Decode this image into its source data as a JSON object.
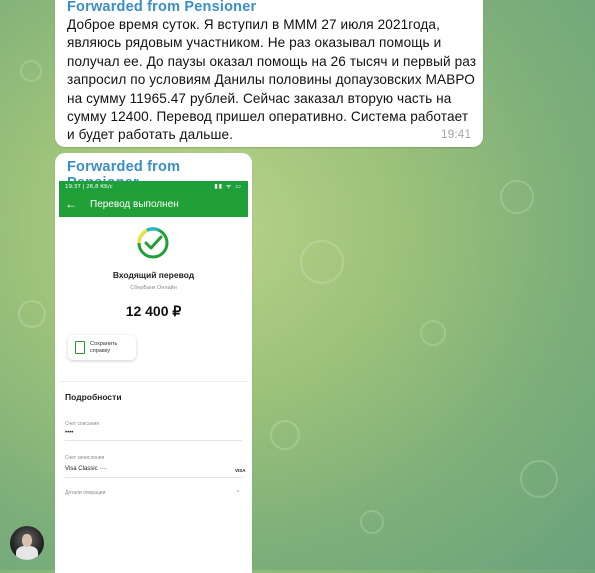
{
  "message1": {
    "forwarded_from": "Forwarded from Pensioner",
    "text": "Доброе время суток. Я вступил в МММ 27 июля 2021года, являюсь рядовым участником. Не раз оказывал помощь и получал ее. До паузы оказал помощь на 26 тысяч и первый раз запросил по условиям Данилы половины допаузовских МАВРО на сумму 11965.47 рублей. Сейчас заказал вторую часть на сумму 12400. Перевод пришел оперативно. Система работает и будет работать дальше.",
    "time": "19:41"
  },
  "message2": {
    "forwarded_from": "Forwarded from Pensioner",
    "screenshot": {
      "statusbar_text": "19:37 | 26,8 КБ/с",
      "statusbar_right": "▮▮ ᯤ ▭",
      "appbar_title": "Перевод выполнен",
      "transfer_title": "Входящий перевод",
      "transfer_subtitle": "СберБанк Онлайн",
      "amount": "12 400 ₽",
      "save_button_label": "Сохранить справку",
      "details_heading": "Подробности",
      "debit_account_label": "Счет списания",
      "debit_account_value": "••••",
      "credit_account_label": "Счет зачисления",
      "credit_account_value": "Visa Classic ····",
      "card_brand": "VISA",
      "operation_details_label": "Детали операции"
    }
  },
  "colors": {
    "sber_green": "#21a038",
    "link_blue": "#3a8ec7"
  }
}
